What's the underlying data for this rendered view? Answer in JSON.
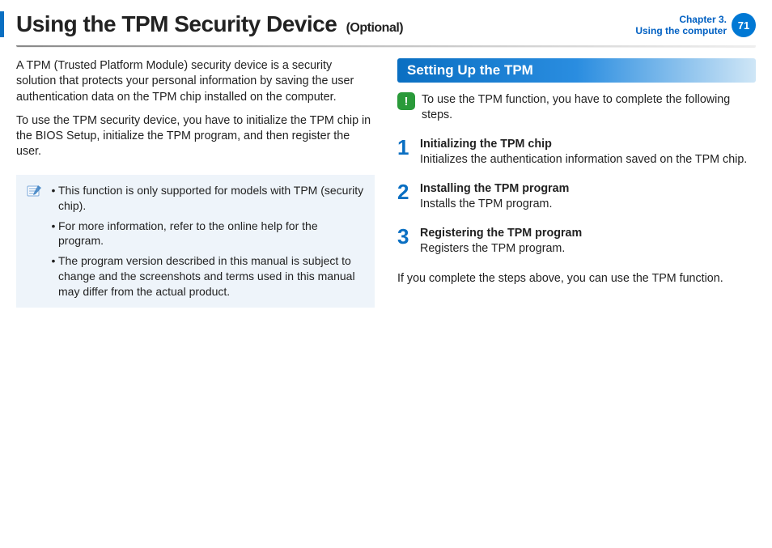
{
  "header": {
    "title": "Using the TPM Security Device",
    "suffix": "(Optional)",
    "chapter_line1": "Chapter 3.",
    "chapter_line2": "Using the computer",
    "page_number": "71"
  },
  "left": {
    "para1": "A TPM (Trusted Platform Module) security device is a security solution that protects your personal information by saving the user authentication data on the TPM chip installed on the computer.",
    "para2": "To use the TPM security device, you have to initialize the TPM chip in the BIOS Setup, initialize the TPM program, and then register the user.",
    "notes": [
      "This function is only supported for models with TPM (security chip).",
      "For more information, refer to the online help for the program.",
      "The program version described in this manual is subject to change and the screenshots and terms used in this manual may differ from the actual product."
    ]
  },
  "right": {
    "section_title": "Setting Up the TPM",
    "alert": "To use the TPM function, you have to complete the following steps.",
    "steps": [
      {
        "num": "1",
        "title": "Initializing the TPM chip",
        "desc": "Initializes the authentication information saved on the TPM chip."
      },
      {
        "num": "2",
        "title": "Installing the TPM program",
        "desc": "Installs the TPM program."
      },
      {
        "num": "3",
        "title": "Registering the TPM program",
        "desc": "Registers the TPM program."
      }
    ],
    "closing": "If you complete the steps above, you can use the TPM function."
  }
}
